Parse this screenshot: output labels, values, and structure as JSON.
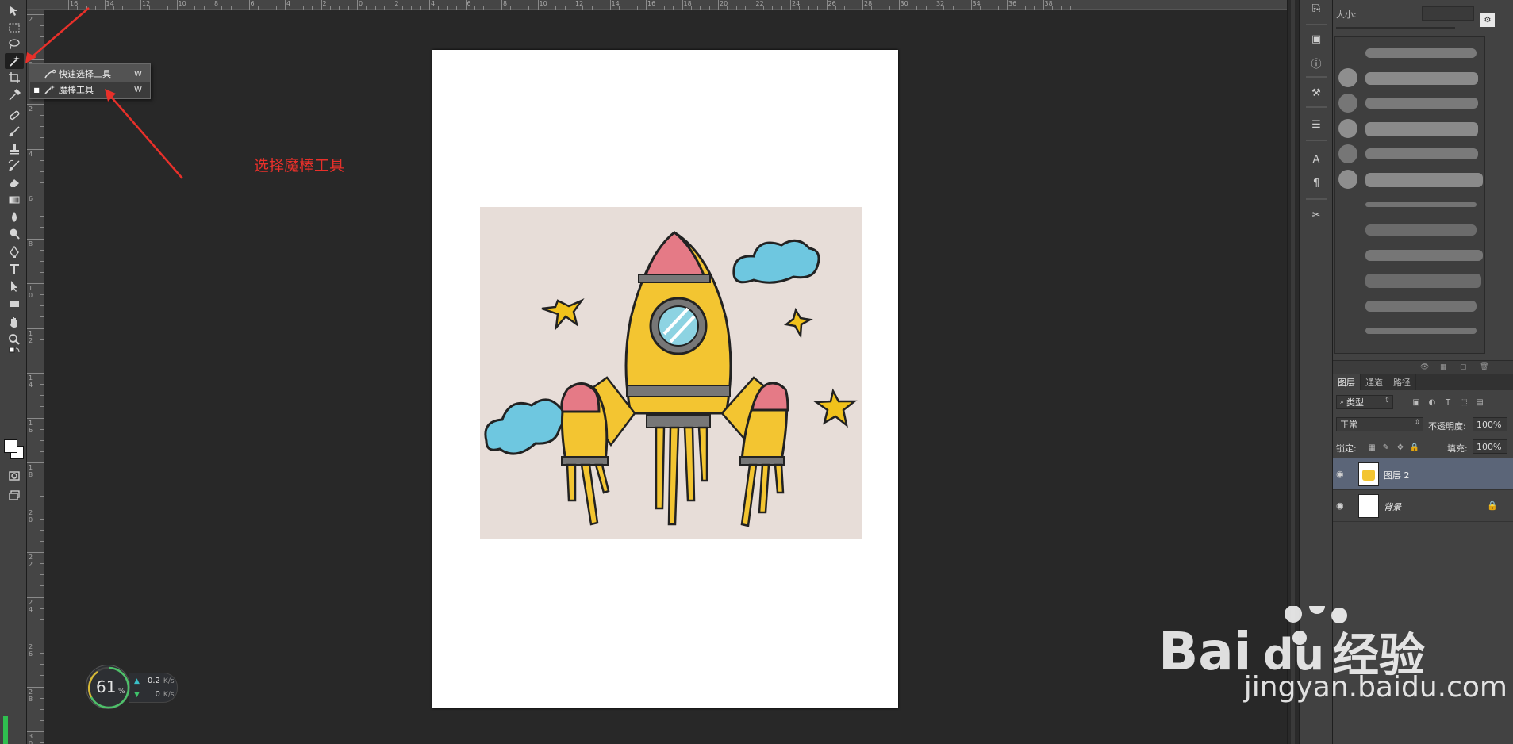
{
  "app": {
    "name": "Adobe Photoshop"
  },
  "toolbar": {
    "tools": [
      "move-tool",
      "marquee-tool",
      "lasso-tool",
      "magic-wand-tool",
      "crop-tool",
      "eyedropper-tool",
      "healing-brush-tool",
      "brush-tool",
      "clone-stamp-tool",
      "history-brush-tool",
      "eraser-tool",
      "gradient-tool",
      "blur-tool",
      "dodge-tool",
      "pen-tool",
      "type-tool",
      "path-selection-tool",
      "rectangle-tool",
      "hand-tool",
      "zoom-tool"
    ],
    "active_tool": "magic-wand-tool"
  },
  "ruler": {
    "top_labels": [
      "16",
      "14",
      "12",
      "10",
      "8",
      "6",
      "4",
      "2",
      "0",
      "2",
      "4",
      "6",
      "8",
      "10",
      "12",
      "14",
      "16",
      "18",
      "20",
      "22",
      "24",
      "26",
      "28",
      "30",
      "32",
      "34",
      "36",
      "38"
    ],
    "left_labels": [
      "2",
      "0",
      "2",
      "4",
      "6",
      "8",
      "10",
      "12",
      "14",
      "16",
      "18",
      "20",
      "22",
      "24",
      "26",
      "28",
      "30"
    ]
  },
  "flyout": {
    "items": [
      {
        "label": "快速选择工具",
        "shortcut": "W",
        "selected": false
      },
      {
        "label": "魔棒工具",
        "shortcut": "W",
        "selected": true
      }
    ]
  },
  "annotation": {
    "text": "选择魔棒工具",
    "color": "#e8302a"
  },
  "perf": {
    "percent": "61",
    "percent_unit": "%",
    "upload": "0.2",
    "upload_unit": "K/s",
    "download": "0",
    "download_unit": "K/s"
  },
  "brush_panel": {
    "size_label": "大小:"
  },
  "layers_panel": {
    "tabs": [
      "图层",
      "通道",
      "路径"
    ],
    "filter_label": "类型",
    "blend_mode": "正常",
    "opacity_label": "不透明度:",
    "opacity_value": "100%",
    "lock_label": "锁定:",
    "fill_label": "填充:",
    "fill_value": "100%",
    "layers": [
      {
        "name": "图层 2",
        "selected": true,
        "locked": false
      },
      {
        "name": "背景",
        "selected": false,
        "locked": true
      }
    ]
  },
  "watermark": {
    "brand": "Bai du 经验",
    "url": "jingyan.baidu.com"
  }
}
